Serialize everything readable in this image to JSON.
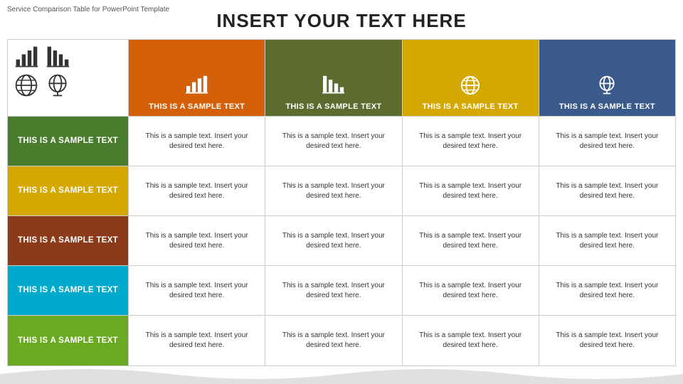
{
  "watermark": "Service Comparison Table for PowerPoint Template",
  "title": "INSERT YOUR TEXT HERE",
  "row_labels": [
    {
      "text": "THIS IS A SAMPLE TEXT",
      "color": "#4a7c2e"
    },
    {
      "text": "THIS IS A SAMPLE TEXT",
      "color": "#d4a800"
    },
    {
      "text": "THIS IS A SAMPLE TEXT",
      "color": "#8b3a1a"
    },
    {
      "text": "THIS IS A SAMPLE TEXT",
      "color": "#00aacc"
    },
    {
      "text": "THIS IS A SAMPLE TEXT",
      "color": "#6aaa22"
    }
  ],
  "columns": [
    {
      "header_text": "THIS IS A SAMPLE TEXT",
      "header_color": "#d4600a",
      "icon": "bar-chart",
      "cells": [
        "This is a sample text. Insert your desired text here.",
        "This is a sample text. Insert your desired text here.",
        "This is a sample text. Insert your desired text here.",
        "This is a sample text. Insert your desired text here.",
        "This is a sample text. Insert your desired text here."
      ]
    },
    {
      "header_text": "THIS IS A SAMPLE TEXT",
      "header_color": "#5c6b2e",
      "icon": "bar-chart-down",
      "cells": [
        "This is a sample text. Insert your desired text here.",
        "This is a sample text. Insert your desired text here.",
        "This is a sample text. Insert your desired text here.",
        "This is a sample text. Insert your desired text here.",
        "This is a sample text. Insert your desired text here."
      ]
    },
    {
      "header_text": "THIS IS A SAMPLE TEXT",
      "header_color": "#d4a800",
      "icon": "globe",
      "cells": [
        "This is a sample text. Insert your desired text here.",
        "This is a sample text. Insert your desired text here.",
        "This is a sample text. Insert your desired text here.",
        "This is a sample text. Insert your desired text here.",
        "This is a sample text. Insert your desired text here."
      ]
    },
    {
      "header_text": "THIS IS A SAMPLE TEXT",
      "header_color": "#3a5a8c",
      "icon": "globe2",
      "cells": [
        "This is a sample text. Insert your desired text here.",
        "This is a sample text. Insert your desired text here.",
        "This is a sample text. Insert your desired text here.",
        "This is a sample text. Insert your desired text here.",
        "This is a sample text. Insert your desired text here."
      ]
    }
  ],
  "top_icons": [
    {
      "type": "bar-chart",
      "row": 1,
      "col": 1
    },
    {
      "type": "bar-chart-down",
      "row": 1,
      "col": 2
    },
    {
      "type": "globe",
      "row": 2,
      "col": 1
    },
    {
      "type": "globe2",
      "row": 2,
      "col": 2
    }
  ]
}
